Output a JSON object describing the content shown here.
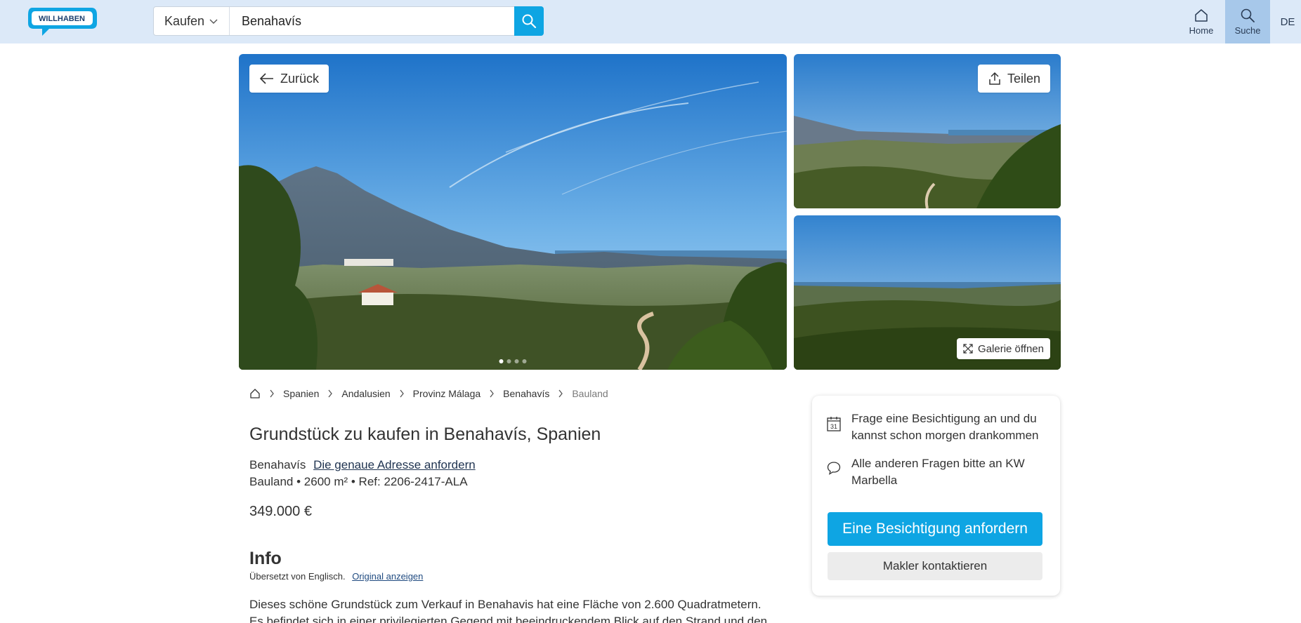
{
  "header": {
    "logo_text": "WILLHABEN",
    "search_mode": "Kaufen",
    "search_value": "Benahavís",
    "nav": {
      "home": "Home",
      "search": "Suche",
      "language": "DE"
    }
  },
  "gallery": {
    "back_label": "Zurück",
    "share_label": "Teilen",
    "open_gallery_label": "Galerie öffnen",
    "dot_count": 4,
    "active_dot": 1
  },
  "breadcrumb": {
    "items": [
      "Spanien",
      "Andalusien",
      "Provinz Málaga",
      "Benahavís",
      "Bauland"
    ]
  },
  "listing": {
    "title": "Grundstück zu kaufen in Benahavís, Spanien",
    "location": "Benahavís",
    "address_link": "Die genaue Adresse anfordern",
    "specs": "Bauland • 2600 m² • Ref: 2206-2417-ALA",
    "price": "349.000 €",
    "info_heading": "Info",
    "translated_note": "Übersetzt von Englisch.",
    "original_link": "Original anzeigen",
    "description": "Dieses schöne Grundstück zum Verkauf in Benahavis hat eine Fläche von 2.600 Quadratmetern. Es befindet sich in einer privilegierten Gegend mit beeindruckendem Blick auf den Strand und den"
  },
  "contact": {
    "viewing_text": "Frage eine Besichtigung an und du kannst schon morgen drankommen",
    "questions_text": "Alle anderen Fragen bitte an KW Marbella",
    "primary_button": "Eine Besichtigung anfordern",
    "secondary_button": "Makler kontaktieren",
    "calendar_day": "31"
  },
  "colors": {
    "header_bg": "#dce9f8",
    "accent": "#0ea5e3",
    "active_nav": "#a7c8ea",
    "logo_blue": "#0a6fb5"
  }
}
